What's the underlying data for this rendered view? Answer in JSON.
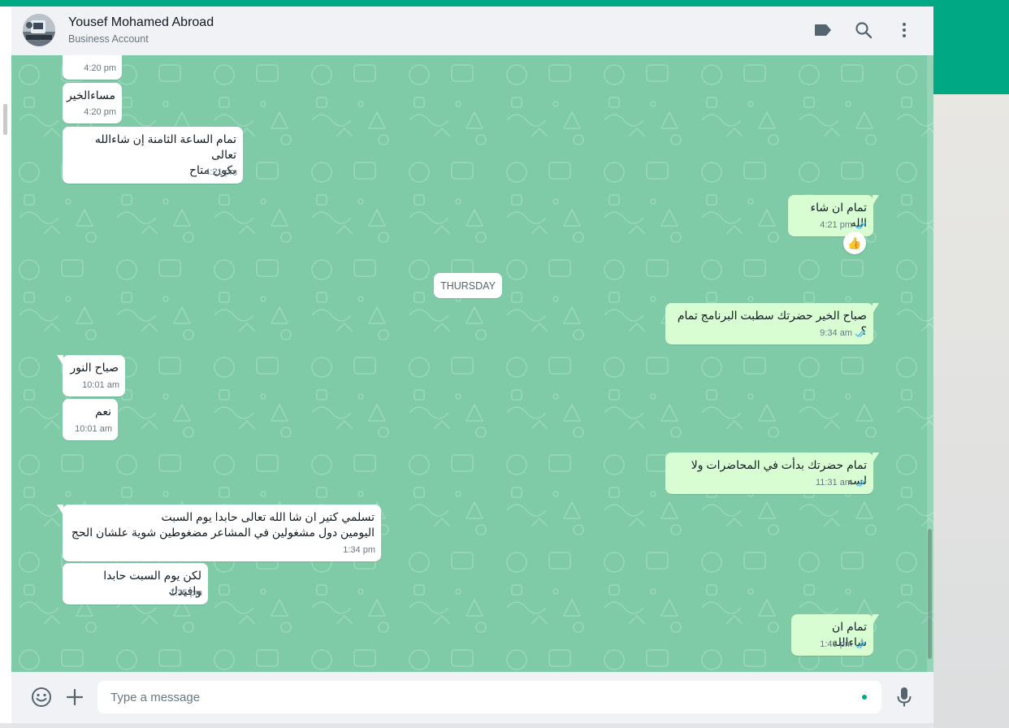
{
  "colors": {
    "accent": "#00a884",
    "chat_bg": "#7fcba8",
    "incoming_bubble": "#ffffff",
    "outgoing_bubble": "#d9fdd3",
    "read_tick": "#53bdeb"
  },
  "header": {
    "name": "Yousef Mohamed Abroad",
    "subtitle": "Business Account",
    "icons": [
      "label-icon",
      "search-icon",
      "menu-icon"
    ]
  },
  "date_separator": "THURSDAY",
  "messages": [
    {
      "dir": "in",
      "text": "",
      "time": "4:20 pm"
    },
    {
      "dir": "in",
      "text": "مساءالخير",
      "time": "4:20 pm"
    },
    {
      "dir": "in",
      "text": "تمام الساعة الثامنة إن شاءالله تعالى\nبكون متاح",
      "time": "4:21 pm"
    },
    {
      "dir": "out",
      "text": "تمام ان شاء الله",
      "time": "4:21 pm",
      "read": true,
      "reaction": "👍"
    },
    {
      "dir": "out",
      "text": "صباح الخير حضرتك سطبت البرنامج تمام ؟",
      "time": "9:34 am",
      "read": true
    },
    {
      "dir": "in",
      "text": "صباح النور",
      "time": "10:01 am"
    },
    {
      "dir": "in",
      "text": "نعم",
      "time": "10:01 am"
    },
    {
      "dir": "out",
      "text": "تمام حضرتك بدأت في المحاضرات ولا لسه",
      "time": "11:31 am",
      "read": true
    },
    {
      "dir": "in",
      "text": "تسلمي كتير ان شا الله تعالى حابدا يوم السبت\nاليومين دول مشغولين في المشاعر مضغوطين شوية علشان الحج",
      "time": "1:34 pm"
    },
    {
      "dir": "in",
      "text": "لكن يوم السبت حابدا وافيدك",
      "time": "1:35 pm"
    },
    {
      "dir": "out",
      "text": "تمام ان شاءالله",
      "time": "1:46 pm",
      "read": true
    }
  ],
  "composer": {
    "placeholder": "Type a message",
    "icons": [
      "emoji-icon",
      "attach-plus-icon",
      "microphone-icon"
    ]
  }
}
